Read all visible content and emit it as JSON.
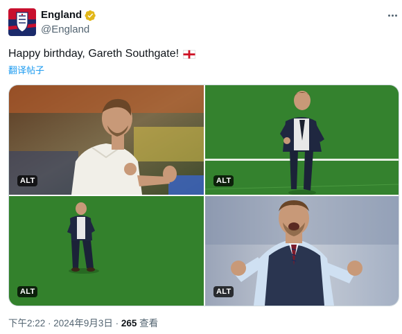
{
  "account": {
    "display_name": "England",
    "handle": "@England",
    "verified_icon": "verified-badge-icon",
    "avatar_icon": "england-crest-icon"
  },
  "tweet": {
    "text": "Happy birthday, Gareth Southgate!",
    "emoji_icon": "england-flag-icon",
    "translate_label": "翻译帖子"
  },
  "media": {
    "photos": [
      {
        "alt_label": "ALT"
      },
      {
        "alt_label": "ALT"
      },
      {
        "alt_label": "ALT"
      },
      {
        "alt_label": "ALT"
      }
    ]
  },
  "meta": {
    "time": "下午2:22",
    "separator": " · ",
    "date": "2024年9月3日",
    "views_count": "265",
    "views_label": " 查看"
  },
  "colors": {
    "text_primary": "#0f1419",
    "text_secondary": "#536471",
    "link": "#1d9bf0",
    "verified_gold": "#e2b719",
    "border": "#cfd9de"
  }
}
